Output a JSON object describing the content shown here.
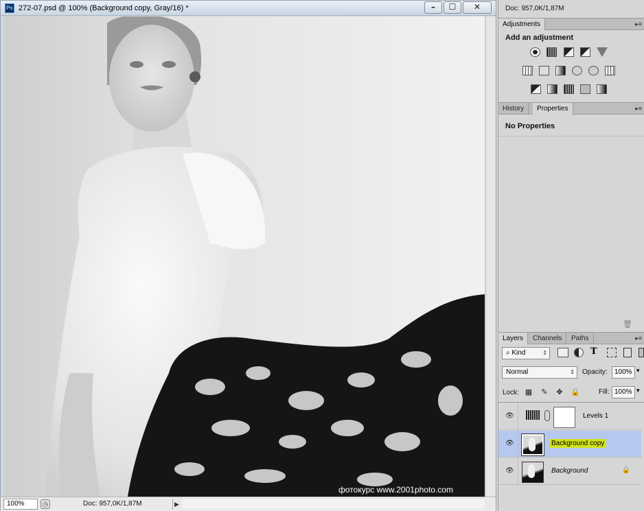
{
  "window": {
    "app_icon": "Ps",
    "title": "272-07.psd @ 100% (Background copy, Gray/16) *",
    "buttons": {
      "minimize": "–",
      "maximize": "☐",
      "close": "✕"
    }
  },
  "canvas": {
    "watermark": "фотокурс   www.2001photo.com"
  },
  "status": {
    "zoom": "100%",
    "doc": "Doc: 957,0K/1,87M"
  },
  "panels": {
    "doc_info": "Doc: 957,0K/1,87M",
    "adjustments": {
      "tab": "Adjustments",
      "heading": "Add an adjustment",
      "icons": [
        "brightness-contrast-icon",
        "levels-icon",
        "curves-icon",
        "exposure-icon",
        "vibrance-icon",
        "hue-saturation-icon",
        "color-balance-icon",
        "black-white-icon",
        "photo-filter-icon",
        "channel-mixer-icon",
        "color-lookup-icon",
        "invert-icon",
        "posterize-icon",
        "threshold-icon",
        "selective-color-icon",
        "gradient-map-icon"
      ]
    },
    "history_properties": {
      "tabs": [
        "History",
        "Properties"
      ],
      "active": "Properties",
      "heading": "No Properties"
    },
    "layers": {
      "tabs": [
        "Layers",
        "Channels",
        "Paths"
      ],
      "filter": "Kind",
      "blend_mode": "Normal",
      "opacity_label": "Opacity:",
      "opacity": "100%",
      "lock_label": "Lock:",
      "fill_label": "Fill:",
      "fill": "100%",
      "items": [
        {
          "name": "Levels 1",
          "type": "adjustment",
          "visible": true,
          "selected": false
        },
        {
          "name": "Background copy",
          "type": "pixel",
          "visible": true,
          "selected": true
        },
        {
          "name": "Background",
          "type": "pixel",
          "visible": true,
          "selected": false,
          "locked": true
        }
      ]
    }
  }
}
